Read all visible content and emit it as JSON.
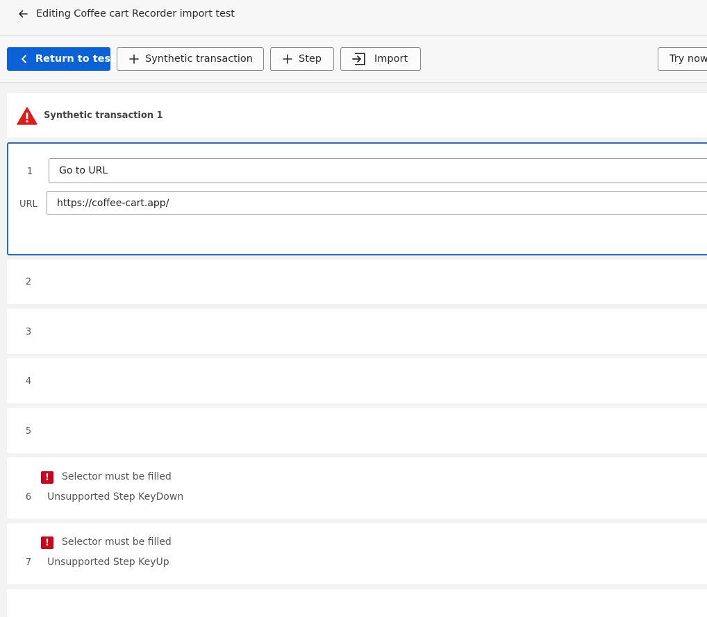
{
  "header": {
    "title": "Editing Coffee cart Recorder import test"
  },
  "toolbar": {
    "return_label": "Return to test",
    "synthetic_label": "Synthetic transaction",
    "step_label": "Step",
    "import_label": "Import",
    "try_label": "Try now"
  },
  "transaction": {
    "title": "Synthetic transaction 1"
  },
  "steps": [
    {
      "number": "1",
      "action": "Go to URL",
      "url_label": "URL",
      "url": "https://coffee-cart.app/"
    },
    {
      "number": "2"
    },
    {
      "number": "3"
    },
    {
      "number": "4"
    },
    {
      "number": "5"
    },
    {
      "number": "6",
      "error": "Selector must be filled",
      "text": "Unsupported Step KeyDown"
    },
    {
      "number": "7",
      "error": "Selector must be filled",
      "text": "Unsupported Step KeyUp"
    }
  ],
  "colors": {
    "primary": "#0b62d6",
    "selected_border": "#1c6ed6",
    "error": "#d0021b",
    "warning": "#e01b1b"
  },
  "icons": {
    "back": "arrow-left-icon",
    "return": "chevron-left-icon",
    "add": "plus-icon",
    "import": "import-icon",
    "warning": "warning-triangle-icon",
    "error": "error-exclamation-icon"
  }
}
